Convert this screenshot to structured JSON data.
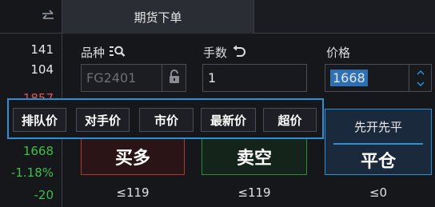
{
  "tab": {
    "label": "期货下单"
  },
  "left_panel": {
    "values": [
      {
        "text": "141",
        "color": "white"
      },
      {
        "text": "104",
        "color": "white"
      },
      {
        "text": "1857",
        "color": "red"
      },
      {
        "text": "1668",
        "color": "green"
      },
      {
        "text": "-1.18%",
        "color": "green"
      },
      {
        "text": "-20",
        "color": "green"
      }
    ]
  },
  "form": {
    "variety_label": "品种",
    "variety_value": "FG2401",
    "qty_label": "手数",
    "qty_value": "1",
    "price_label": "价格",
    "price_value": "1668"
  },
  "price_types": [
    "排队价",
    "对手价",
    "市价",
    "最新价",
    "超价"
  ],
  "actions": {
    "buy_label": "买多",
    "sell_label": "卖空",
    "close_mode": "先开先平",
    "close_label": "平仓"
  },
  "limits": {
    "buy": "≤119",
    "sell": "≤119",
    "close": "≤0"
  },
  "colors": {
    "accent": "#2d8fd6",
    "up": "#e5534b",
    "down": "#3fbf4a"
  }
}
